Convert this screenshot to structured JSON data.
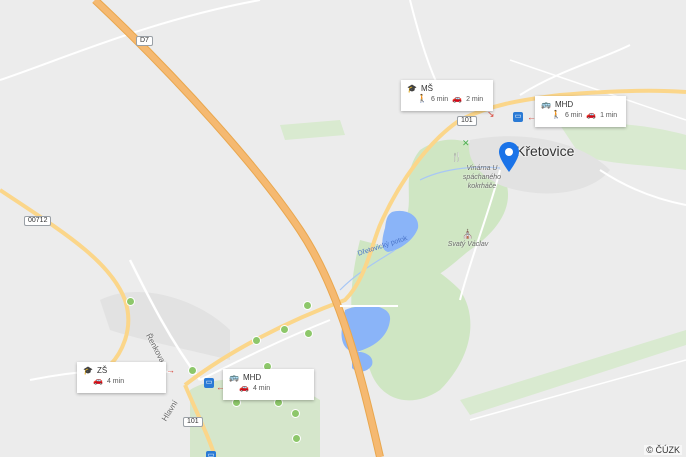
{
  "map": {
    "town_label": "Křetovice",
    "road_labels": {
      "d7": "D7",
      "r101_top": "101",
      "r101_bottom": "101",
      "r00712": "00712"
    },
    "poi_labels": {
      "vinarna": "Vinárna U spáchaného kokrháče",
      "church": "Svatý Václav"
    },
    "street_labels": {
      "renkova": "Řenkova",
      "hlavni": "Hlavní"
    },
    "water_label": "Dřetovický potok",
    "copyright": "© ČÚZK",
    "colors": {
      "background": "#ececec",
      "motorway": "#f5b971",
      "road": "#fbd68a",
      "forest": "#cfe6c3",
      "water": "#8ab4f8",
      "built_up": "#e2e2e2",
      "pin": "#1a73e8"
    }
  },
  "callouts": {
    "ms": {
      "title": "MŠ",
      "title_icon": "school-icon",
      "walk_time": "6 min",
      "car_time": "2 min"
    },
    "mhd_top": {
      "title": "MHD",
      "title_icon": "bus-icon",
      "walk_time": "6 min",
      "car_time": "1 min"
    },
    "zs": {
      "title": "ZŠ",
      "title_icon": "school-icon",
      "car_time": "4 min"
    },
    "mhd_bottom": {
      "title": "MHD",
      "title_icon": "bus-icon",
      "car_time": "4 min"
    }
  }
}
